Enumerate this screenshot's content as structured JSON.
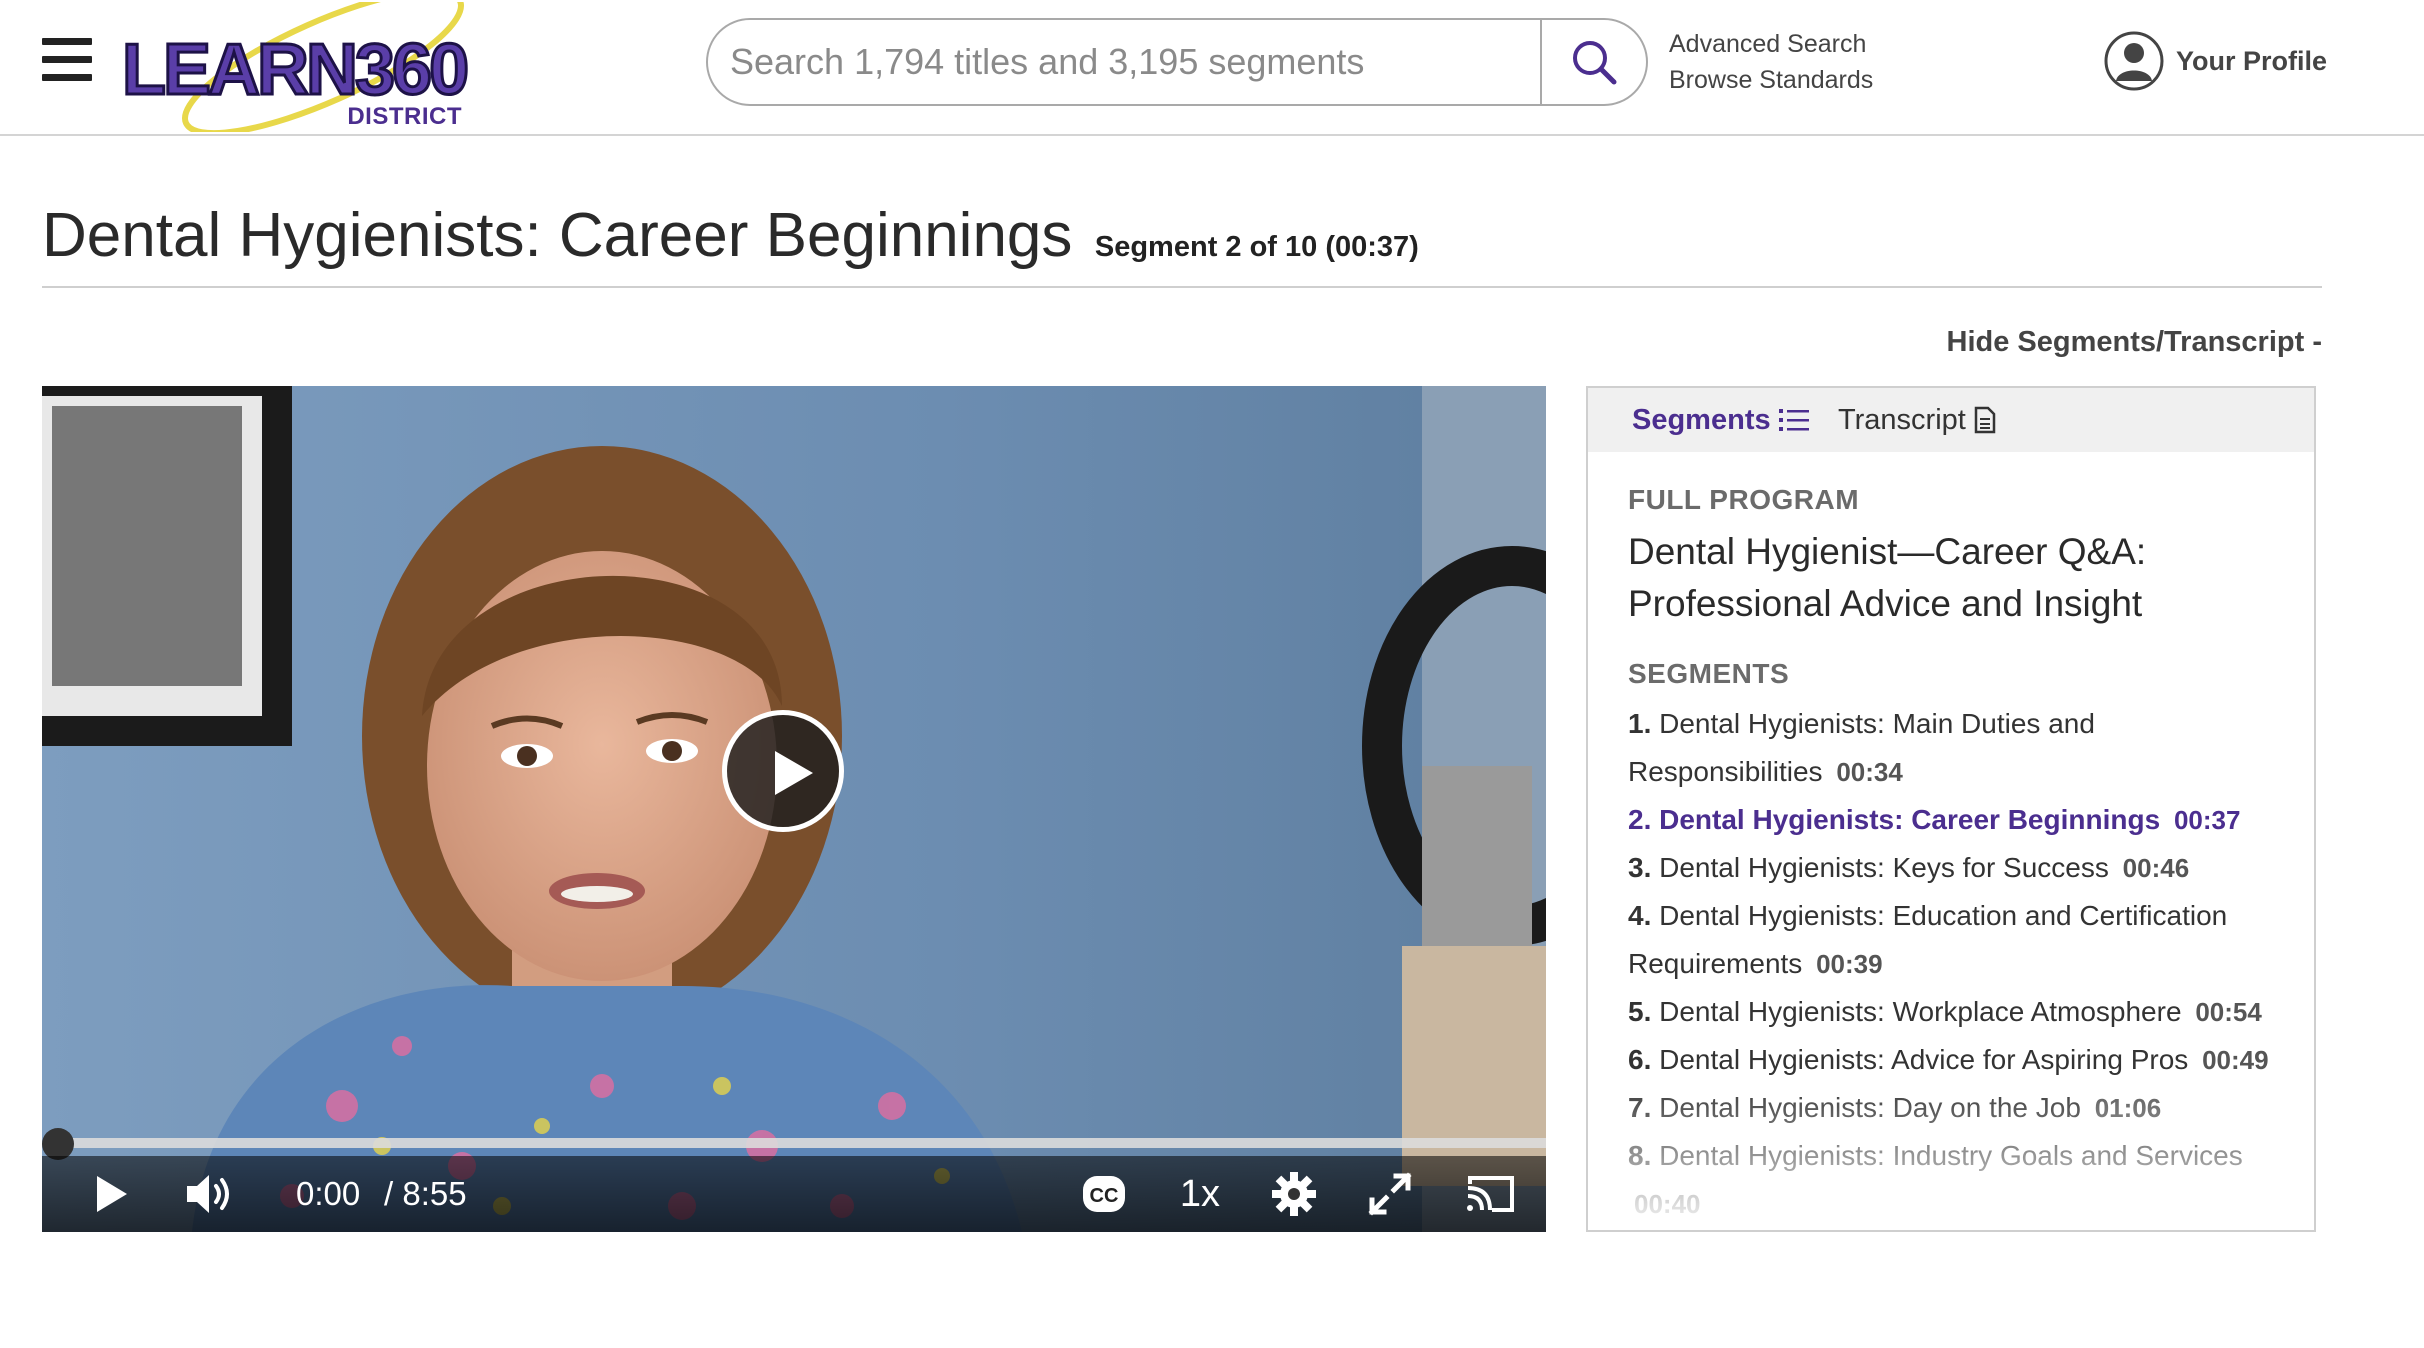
{
  "header": {
    "logo_text": "LEARN360",
    "logo_subtitle": "DISTRICT",
    "search_placeholder": "Search 1,794 titles and 3,195 segments",
    "links": [
      "Advanced Search",
      "Browse Standards"
    ],
    "profile_label": "Your Profile"
  },
  "page": {
    "title": "Dental Hygienists: Career Beginnings",
    "segment_info": "Segment 2 of 10 (00:37)",
    "hide_link": "Hide Segments/Transcript -"
  },
  "player": {
    "current_time": "0:00",
    "duration": "/ 8:55",
    "speed": "1x",
    "progress_fraction": 0,
    "icons": [
      "play-icon",
      "volume-icon",
      "closed-captions-icon",
      "settings-icon",
      "fullscreen-icon",
      "cast-icon"
    ]
  },
  "panel": {
    "tabs": {
      "segments": "Segments",
      "transcript": "Transcript"
    },
    "full_program_label": "FULL PROGRAM",
    "program_title": "Dental Hygienist—Career Q&A: Professional Advice and Insight",
    "segments_label": "SEGMENTS",
    "segments": [
      {
        "num": "1.",
        "title": "Dental Hygienists: Main Duties and Responsibilities",
        "duration": "00:34",
        "active": false
      },
      {
        "num": "2.",
        "title": "Dental Hygienists: Career Beginnings",
        "duration": "00:37",
        "active": true
      },
      {
        "num": "3.",
        "title": "Dental Hygienists: Keys for Success",
        "duration": "00:46",
        "active": false
      },
      {
        "num": "4.",
        "title": "Dental Hygienists: Education and Certification Requirements",
        "duration": "00:39",
        "active": false
      },
      {
        "num": "5.",
        "title": "Dental Hygienists: Workplace Atmosphere",
        "duration": "00:54",
        "active": false
      },
      {
        "num": "6.",
        "title": "Dental Hygienists: Advice for Aspiring Pros",
        "duration": "00:49",
        "active": false
      },
      {
        "num": "7.",
        "title": "Dental Hygienists: Day on the Job",
        "duration": "01:06",
        "active": false
      },
      {
        "num": "8.",
        "title": "Dental Hygienists: Industry Goals and Services",
        "duration": "00:40",
        "active": false
      }
    ]
  },
  "colors": {
    "accent": "#4b2e8f",
    "logo_yellow": "#e8d84a",
    "text": "#222222"
  }
}
